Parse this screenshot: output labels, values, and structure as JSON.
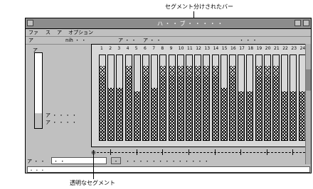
{
  "callouts": {
    "top": "セグメント分けされたバー",
    "bottom": "透明なセグメント"
  },
  "window": {
    "title": "ハ ・ ・ ブ ・ ・ ・ ・ ・"
  },
  "menu": {
    "file": "ファ",
    "edit": "ス",
    "view": "ア",
    "options": "オプション"
  },
  "header": {
    "col1": "ア",
    "col2": "nih ・ ・",
    "col3": "ア ・ ・",
    "col4": "ア ・ ・",
    "col5": "・ ・ ・"
  },
  "left_panel": {
    "label": "ア",
    "legend1": "ア ・ ・ ・ ・",
    "legend2": "ア ・ ・ ・ ・"
  },
  "channels": [
    "1",
    "2",
    "3",
    "4",
    "5",
    "6",
    "7",
    "8",
    "9",
    "10",
    "11",
    "12",
    "13",
    "14",
    "15",
    "16",
    "17",
    "18",
    "19",
    "20",
    "21",
    "22",
    "23",
    "24"
  ],
  "bar_fill": [
    0.88,
    0.62,
    0.62,
    0.88,
    0.58,
    0.88,
    0.62,
    0.88,
    0.88,
    0.88,
    0.88,
    0.88,
    0.88,
    0.88,
    0.62,
    0.88,
    0.58,
    0.58,
    0.88,
    0.88,
    0.88,
    0.58,
    0.58,
    0.58
  ],
  "left_fill": 0.2,
  "status": {
    "label": "ア ・ ・",
    "field_value": "・ ・",
    "nav": "・",
    "info": "・ ・ ・ ・ ・ ・ ・ ・ ・ ・ ・ ・ ・"
  },
  "bottom": {
    "value": "・ ・ ・"
  }
}
